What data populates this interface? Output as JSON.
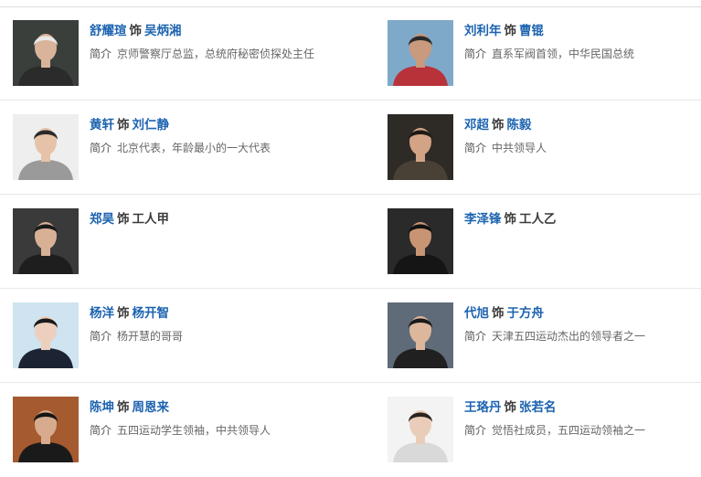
{
  "cast": [
    {
      "actor": "舒耀瑄",
      "plays": "饰",
      "role": "吴炳湘",
      "intro_label": "简介",
      "intro": "京师警察厅总监，总统府秘密侦探处主任",
      "role_link": true,
      "bg": "#3a3f3c",
      "skin": "#d9b49a",
      "cloth": "#2b2b2b",
      "hair": "#e8e8e8"
    },
    {
      "actor": "刘利年",
      "plays": "饰",
      "role": "曹锟",
      "intro_label": "简介",
      "intro": "直系军阀首领，中华民国总统",
      "role_link": true,
      "bg": "#7fa9c9",
      "skin": "#c99a7d",
      "cloth": "#b8323a",
      "hair": "#2a2a2a"
    },
    {
      "actor": "黄轩",
      "plays": "饰",
      "role": "刘仁静",
      "intro_label": "简介",
      "intro": "北京代表，年龄最小的一大代表",
      "role_link": true,
      "bg": "#eeeeee",
      "skin": "#e6c3a8",
      "cloth": "#9a9a9a",
      "hair": "#2a2a2a"
    },
    {
      "actor": "邓超",
      "plays": "饰",
      "role": "陈毅",
      "intro_label": "简介",
      "intro": "中共领导人",
      "role_link": true,
      "bg": "#2e2b27",
      "skin": "#d2a384",
      "cloth": "#4a4136",
      "hair": "#1d1a17"
    },
    {
      "actor": "郑昊",
      "plays": "饰",
      "role": "工人甲",
      "intro_label": "",
      "intro": "",
      "role_link": false,
      "bg": "#3a3a3a",
      "skin": "#d8b096",
      "cloth": "#1e1e1e",
      "hair": "#1a1a1a"
    },
    {
      "actor": "李泽锋",
      "plays": "饰",
      "role": "工人乙",
      "intro_label": "",
      "intro": "",
      "role_link": false,
      "bg": "#2a2a2a",
      "skin": "#c79474",
      "cloth": "#151515",
      "hair": "#111111"
    },
    {
      "actor": "杨洋",
      "plays": "饰",
      "role": "杨开智",
      "intro_label": "简介",
      "intro": "杨开慧的哥哥",
      "role_link": true,
      "bg": "#cfe3f1",
      "skin": "#ecd0bd",
      "cloth": "#1c2433",
      "hair": "#1a1a1a"
    },
    {
      "actor": "代旭",
      "plays": "饰",
      "role": "于方舟",
      "intro_label": "简介",
      "intro": "天津五四运动杰出的领导者之一",
      "role_link": true,
      "bg": "#5f6b78",
      "skin": "#dcb79c",
      "cloth": "#202020",
      "hair": "#1a1a1a"
    },
    {
      "actor": "陈坤",
      "plays": "饰",
      "role": "周恩来",
      "intro_label": "简介",
      "intro": "五四运动学生领袖，中共领导人",
      "role_link": true,
      "bg": "#a55a2f",
      "skin": "#d7ab8d",
      "cloth": "#1a1a1a",
      "hair": "#161616"
    },
    {
      "actor": "王珞丹",
      "plays": "饰",
      "role": "张若名",
      "intro_label": "简介",
      "intro": "觉悟社成员，五四运动领袖之一",
      "role_link": true,
      "bg": "#f3f3f3",
      "skin": "#eacdb9",
      "cloth": "#d9d9d9",
      "hair": "#2a2420"
    }
  ]
}
